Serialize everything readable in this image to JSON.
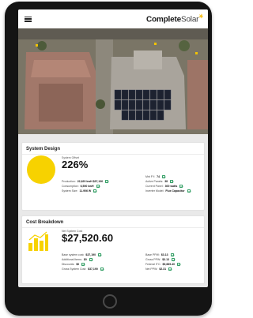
{
  "header": {
    "brand_bold": "Complete",
    "brand_light": "Solar"
  },
  "system_design": {
    "title": "System Design",
    "offset_label": "System Offset",
    "offset_value": "226%",
    "left_rows": [
      {
        "key": "Production:",
        "value": "22,620 kwH $37,190"
      },
      {
        "key": "Consumption:",
        "value": "6,500 kwH"
      },
      {
        "key": "System Size:",
        "value": "11.906 W"
      }
    ],
    "right_rows": [
      {
        "key": "Mnt FY:",
        "value": "74"
      },
      {
        "key": "Active Panels:",
        "value": "38"
      },
      {
        "key": "Current Panel:",
        "value": "300 watts"
      },
      {
        "key": "Inverter Model:",
        "value": "Flux Capacitor"
      }
    ]
  },
  "cost_breakdown": {
    "title": "Cost Breakdown",
    "net_label": "Net System Cost",
    "net_value": "$27,520.60",
    "left_rows": [
      {
        "key": "Base system cost:",
        "value": "$37,190"
      },
      {
        "key": "Additional Items:",
        "value": "$0"
      },
      {
        "key": "Discounts:",
        "value": "$0"
      },
      {
        "key": "Gross System Cost:",
        "value": "$37,190"
      }
    ],
    "right_rows": [
      {
        "key": "Base PPW:",
        "value": "$3.13"
      },
      {
        "key": "Gross PPW:",
        "value": "$3.13"
      },
      {
        "key": "Federal ITC:",
        "value": "$9,669.40"
      },
      {
        "key": "Net PPW:",
        "value": "$2.31"
      }
    ]
  },
  "colors": {
    "accent": "#f7d200",
    "check": "#38a169"
  }
}
